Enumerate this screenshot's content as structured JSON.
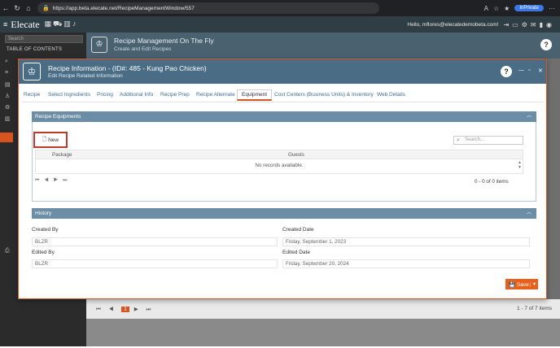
{
  "browser": {
    "url": "https://app.beta.elecate.net/RecipeManagementWindow/557",
    "inprivate_label": "InPrivate",
    "more_glyph": "···"
  },
  "app_header": {
    "logo_text": "Elecate",
    "user_greeting": "Hello, mflores@elecatedemobeta.com!"
  },
  "sidebar": {
    "search_placeholder": "Search",
    "toc_label": "TABLE OF CONTENTS"
  },
  "page": {
    "title": "Recipe Management On The Fly",
    "subtitle": "Create and Edit Recipes",
    "help_glyph": "?",
    "pager_current": "1",
    "items_count": "1 - 7 of 7 items"
  },
  "modal": {
    "title": "Recipe Information - (ID#: 485 - Kung Pao Chicken)",
    "subtitle": "Edit Recipe Related Information",
    "help_glyph": "?",
    "tabs": [
      {
        "label": "Recipe"
      },
      {
        "label": "Select Ingredients"
      },
      {
        "label": "Pricing"
      },
      {
        "label": "Additional Info"
      },
      {
        "label": "Recipe Prep"
      },
      {
        "label": "Recipe Alternate"
      },
      {
        "label": "Equipment"
      },
      {
        "label": "Cost Centers (Business Units) & Inventory"
      },
      {
        "label": "Web Details"
      }
    ],
    "active_tab": "Equipment",
    "equipment": {
      "section_title": "Recipe Equipments",
      "new_button": "New",
      "search_placeholder": "Search...",
      "columns": [
        "Package",
        "Guests"
      ],
      "empty_text": "No records available.",
      "items_count": "0 - 0 of 0 items"
    },
    "history": {
      "section_title": "History",
      "created_by_label": "Created By",
      "created_by_value": "BLZR",
      "created_date_label": "Created Date",
      "created_date_value": "Friday, September 1, 2023",
      "edited_by_label": "Edited By",
      "edited_by_value": "BLZR",
      "edited_date_label": "Edited Date",
      "edited_date_value": "Friday, September 20, 2024"
    },
    "save_button": "Save"
  },
  "colors": {
    "accent": "#d9531e",
    "header": "#4a6d85",
    "panel_header": "#6b8ea6",
    "save": "#e8601c"
  }
}
